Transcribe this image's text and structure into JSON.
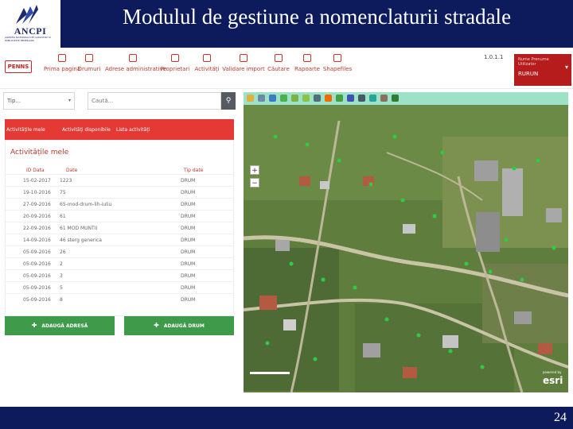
{
  "slide": {
    "title": "Modulul de gestiune a nomenclaturii stradale",
    "page_number": "24"
  },
  "logo": {
    "name": "ANCPI",
    "subtitle": "AGENTIA NATIONALA DE CADASTRU SI PUBLICITATE IMOBILIARA"
  },
  "app": {
    "brand": "PENNS",
    "version": "1.0.1.1",
    "user": {
      "name": "Nume Prenume Utilizator",
      "role": "RURUN"
    },
    "nav": [
      {
        "label": "Prima pagină",
        "icon": "home-icon"
      },
      {
        "label": "Drumuri",
        "icon": "signpost-icon"
      },
      {
        "label": "Adrese administrative",
        "icon": "address-icon"
      },
      {
        "label": "Proprietari",
        "icon": "owners-icon"
      },
      {
        "label": "Activități",
        "icon": "edit-icon"
      },
      {
        "label": "Validare import",
        "icon": "validate-icon"
      },
      {
        "label": "Căutare",
        "icon": "search-icon"
      },
      {
        "label": "Rapoarte",
        "icon": "report-icon"
      },
      {
        "label": "Shapefiles",
        "icon": "shapefile-icon"
      }
    ],
    "filter": {
      "value": "Tip..."
    },
    "search": {
      "placeholder": "Caută..."
    },
    "tabs": [
      "Activitățile mele",
      "Activități disponibile",
      "Lista activități"
    ],
    "panel": {
      "title": "Activitățile mele",
      "columns": [
        "ID Data",
        "Date",
        "Tip date"
      ],
      "rows": [
        [
          "15-02-2017",
          "1223",
          "DRUM"
        ],
        [
          "19-10-2016",
          "75",
          "DRUM"
        ],
        [
          "27-09-2016",
          "65-mod-drum-lih-iuliu",
          "DRUM"
        ],
        [
          "20-09-2016",
          "61",
          "DRUM"
        ],
        [
          "22-09-2016",
          "61 MOD MUNTII",
          "DRUM"
        ],
        [
          "14-09-2016",
          "46 sterg generica",
          "DRUM"
        ],
        [
          "05-09-2016",
          "26",
          "DRUM"
        ],
        [
          "05-09-2016",
          "2",
          "DRUM"
        ],
        [
          "05-09-2016",
          "3",
          "DRUM"
        ],
        [
          "05-09-2016",
          "5",
          "DRUM"
        ],
        [
          "05-09-2016",
          "8",
          "DRUM"
        ]
      ]
    },
    "buttons": {
      "add_address": "ADAUGĂ ADRESĂ",
      "add_road": "ADAUGĂ DRUM"
    },
    "map": {
      "attribution_small": "powered by",
      "attribution": "esri"
    }
  }
}
